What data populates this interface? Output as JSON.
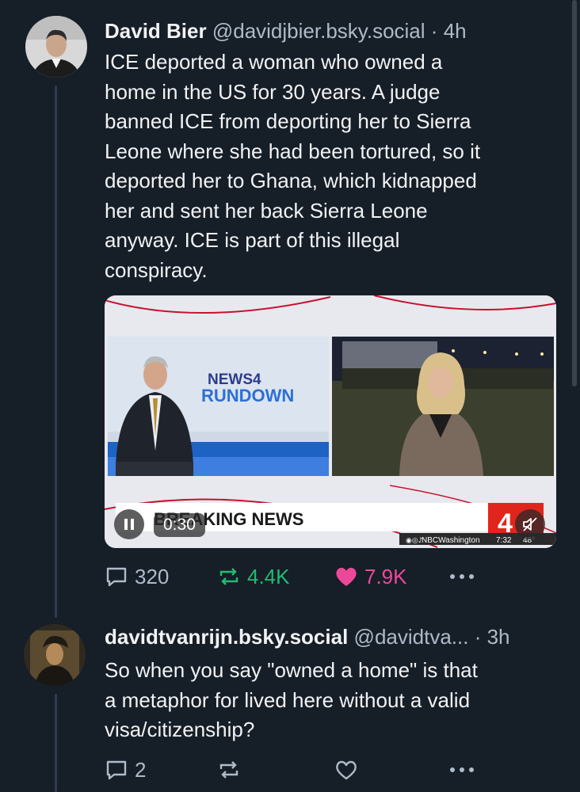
{
  "posts": [
    {
      "author": "David Bier",
      "handle": "@davidjbier.bsky.social",
      "separator": "·",
      "time": "4h",
      "text": "ICE deported a woman who owned a\nhome in the US for 30 years. A judge\nbanned ICE from deporting her to Sierra\nLeone where she had been tortured, so it\ndeported her to Ghana, which kidnapped\nher and sent her back Sierra Leone\nanyway. ICE is part of this illegal\nconspiracy.",
      "video": {
        "logo_top": "NEWS4",
        "logo_bottom": "RUNDOWN",
        "banner": "BREAKING NEWS",
        "duration": "0:30",
        "social_handle": "NBCWashington",
        "clock": "7:32",
        "temperature": "48°",
        "channel": "4"
      },
      "replies": "320",
      "reposts": "4.4K",
      "likes": "7.9K",
      "colors": {
        "repost": "#20bc72",
        "like": "#ec4899"
      }
    },
    {
      "author": "davidtvanrijn.bsky.social",
      "handle": "@davidtva...",
      "separator": "·",
      "time": "3h",
      "text": "So when you say \"owned a home\" is that\na metaphor for lived here without a valid\nvisa/citizenship?",
      "replies": "2"
    }
  ]
}
